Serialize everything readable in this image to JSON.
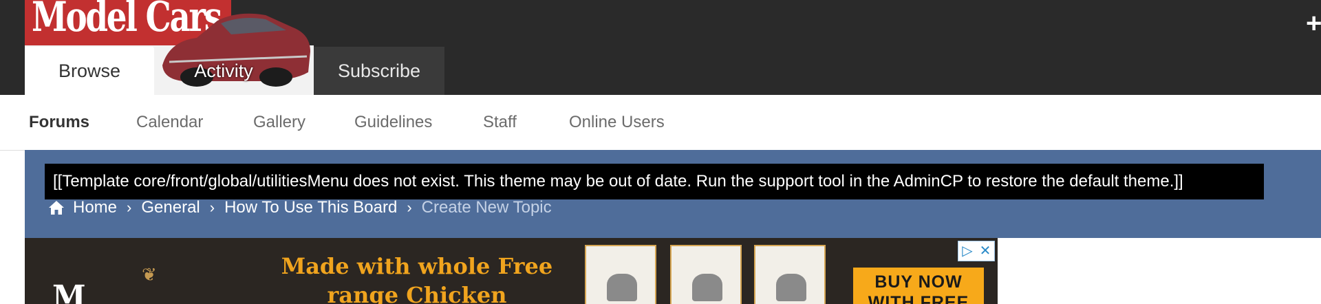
{
  "header": {
    "logo_text": "Model Cars",
    "tabs": [
      {
        "label": "Browse",
        "active": true
      },
      {
        "label": "Activity",
        "active": false
      },
      {
        "label": "Subscribe",
        "active": false
      }
    ],
    "plus_icon": "plus-icon"
  },
  "subnav": {
    "items": [
      {
        "label": "Forums",
        "active": true
      },
      {
        "label": "Calendar",
        "active": false
      },
      {
        "label": "Gallery",
        "active": false
      },
      {
        "label": "Guidelines",
        "active": false
      },
      {
        "label": "Staff",
        "active": false
      },
      {
        "label": "Online Users",
        "active": false
      }
    ]
  },
  "template_error": "[[Template core/front/global/utilitiesMenu does not exist. This theme may be out of date. Run the support tool in the AdminCP to restore the default theme.]]",
  "breadcrumb": {
    "home_icon": "home-icon",
    "items": [
      {
        "label": "Home"
      },
      {
        "label": "General"
      },
      {
        "label": "How To Use This Board"
      },
      {
        "label": "Create New Topic",
        "current": true
      }
    ]
  },
  "ad": {
    "headline": "Made with whole Free range Chicken",
    "cta": "BUY NOW WITH FREE",
    "choices_icon": "ad-choices-icon",
    "close_icon": "close-icon"
  },
  "colors": {
    "header_bg": "#2a2a2a",
    "band_bg": "#4f6d9a",
    "logo_red": "#c23030",
    "ad_accent": "#f0a41e"
  }
}
